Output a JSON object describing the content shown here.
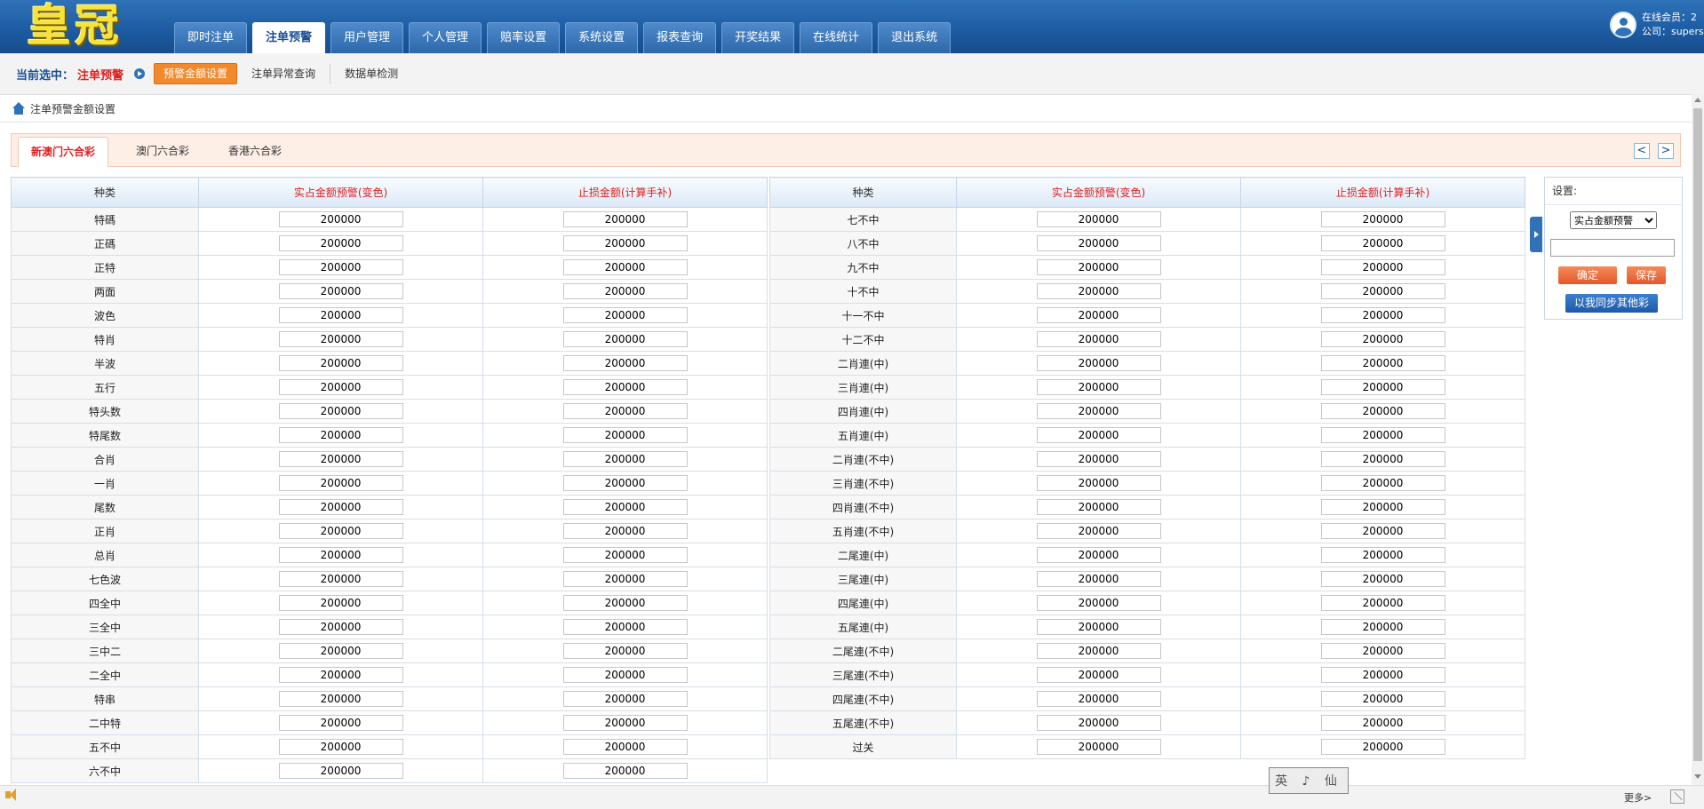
{
  "header": {
    "logo": "皇冠",
    "nav": [
      "即时注单",
      "注单预警",
      "用户管理",
      "个人管理",
      "赔率设置",
      "系统设置",
      "报表查询",
      "开奖结果",
      "在线统计",
      "退出系统"
    ],
    "nav_active_index": 1,
    "online": "在线会员：2",
    "company": "公司：supers"
  },
  "subbar": {
    "label": "当前选中：",
    "current": "注单预警",
    "tabs": [
      "预警金额设置",
      "注单异常查询",
      "数据单检测"
    ]
  },
  "breadcrumb": "注单预警金额设置",
  "game_tabs": [
    "新澳门六合彩",
    "澳门六合彩",
    "香港六合彩"
  ],
  "pager": {
    "prev": "<",
    "next": ">"
  },
  "table": {
    "headers": [
      "种类",
      "实占金额预警(变色)",
      "止损金额(计算手补)"
    ],
    "left": [
      [
        "特碼",
        "200000",
        "200000"
      ],
      [
        "正碼",
        "200000",
        "200000"
      ],
      [
        "正特",
        "200000",
        "200000"
      ],
      [
        "两面",
        "200000",
        "200000"
      ],
      [
        "波色",
        "200000",
        "200000"
      ],
      [
        "特肖",
        "200000",
        "200000"
      ],
      [
        "半波",
        "200000",
        "200000"
      ],
      [
        "五行",
        "200000",
        "200000"
      ],
      [
        "特头数",
        "200000",
        "200000"
      ],
      [
        "特尾数",
        "200000",
        "200000"
      ],
      [
        "合肖",
        "200000",
        "200000"
      ],
      [
        "一肖",
        "200000",
        "200000"
      ],
      [
        "尾数",
        "200000",
        "200000"
      ],
      [
        "正肖",
        "200000",
        "200000"
      ],
      [
        "总肖",
        "200000",
        "200000"
      ],
      [
        "七色波",
        "200000",
        "200000"
      ],
      [
        "四全中",
        "200000",
        "200000"
      ],
      [
        "三全中",
        "200000",
        "200000"
      ],
      [
        "三中二",
        "200000",
        "200000"
      ],
      [
        "二全中",
        "200000",
        "200000"
      ],
      [
        "特串",
        "200000",
        "200000"
      ],
      [
        "二中特",
        "200000",
        "200000"
      ],
      [
        "五不中",
        "200000",
        "200000"
      ],
      [
        "六不中",
        "200000",
        "200000"
      ]
    ],
    "right": [
      [
        "七不中",
        "200000",
        "200000"
      ],
      [
        "八不中",
        "200000",
        "200000"
      ],
      [
        "九不中",
        "200000",
        "200000"
      ],
      [
        "十不中",
        "200000",
        "200000"
      ],
      [
        "十一不中",
        "200000",
        "200000"
      ],
      [
        "十二不中",
        "200000",
        "200000"
      ],
      [
        "二肖連(中)",
        "200000",
        "200000"
      ],
      [
        "三肖連(中)",
        "200000",
        "200000"
      ],
      [
        "四肖連(中)",
        "200000",
        "200000"
      ],
      [
        "五肖連(中)",
        "200000",
        "200000"
      ],
      [
        "二肖連(不中)",
        "200000",
        "200000"
      ],
      [
        "三肖連(不中)",
        "200000",
        "200000"
      ],
      [
        "四肖連(不中)",
        "200000",
        "200000"
      ],
      [
        "五肖連(不中)",
        "200000",
        "200000"
      ],
      [
        "二尾連(中)",
        "200000",
        "200000"
      ],
      [
        "三尾連(中)",
        "200000",
        "200000"
      ],
      [
        "四尾連(中)",
        "200000",
        "200000"
      ],
      [
        "五尾連(中)",
        "200000",
        "200000"
      ],
      [
        "二尾連(不中)",
        "200000",
        "200000"
      ],
      [
        "三尾連(不中)",
        "200000",
        "200000"
      ],
      [
        "四尾連(不中)",
        "200000",
        "200000"
      ],
      [
        "五尾連(不中)",
        "200000",
        "200000"
      ],
      [
        "过关",
        "200000",
        "200000"
      ]
    ]
  },
  "settings": {
    "title": "设置:",
    "select_value": "实占金额预警",
    "input_value": "",
    "confirm": "确定",
    "save": "保存",
    "sync": "以我同步其他彩"
  },
  "footer": {
    "more": "更多>"
  },
  "ime": "英 ♪ 仙",
  "colors": {
    "header": "#1c5aa1",
    "accent_orange": "#f08a2c",
    "header_red": "#e02020"
  }
}
